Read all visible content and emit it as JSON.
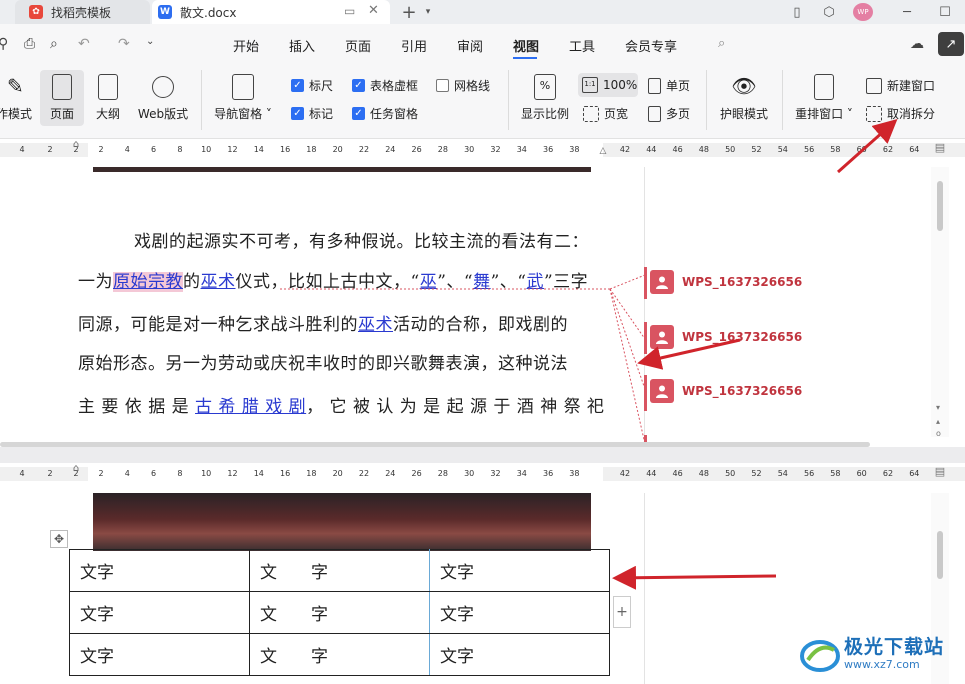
{
  "tabs": [
    {
      "label": "找稻壳模板"
    },
    {
      "label": "散文.docx"
    }
  ],
  "menu": [
    "开始",
    "插入",
    "页面",
    "引用",
    "审阅",
    "视图",
    "工具",
    "会员专享"
  ],
  "menu_active": "视图",
  "ribbon": {
    "write_mode": "作模式",
    "page_view": "页面",
    "outline": "大纲",
    "web_layout": "Web版式",
    "nav_pane": "导航窗格",
    "ruler": "标尺",
    "mark": "标记",
    "table_grid": "表格虚框",
    "task_pane": "任务窗格",
    "gridlines": "网格线",
    "zoom": "显示比例",
    "zoom_100": "100%",
    "page_width": "页宽",
    "single_page": "单页",
    "multi_page": "多页",
    "eye_mode": "护眼模式",
    "rearrange": "重排窗口",
    "new_window": "新建窗口",
    "cancel_split": "取消拆分"
  },
  "ruler_left": [
    "4",
    "2",
    "2"
  ],
  "ruler_main": [
    "2",
    "4",
    "6",
    "8",
    "10",
    "12",
    "14",
    "16",
    "18",
    "20",
    "22",
    "24",
    "26",
    "28",
    "30",
    "32",
    "34",
    "36",
    "38"
  ],
  "ruler_right": [
    "42",
    "44",
    "46",
    "48",
    "50",
    "52",
    "54",
    "56",
    "58",
    "60",
    "62",
    "64"
  ],
  "doc": {
    "line1": "戏剧的起源实不可考，有多种假说。比较主流的看法有二：",
    "line2_a": "一为",
    "line2_b": "原始宗教",
    "line2_c": "的",
    "line2_d": "巫术",
    "line2_e": "仪式，比如上古中文，“",
    "line2_f": "巫",
    "line2_g": "”、“",
    "line2_h": "舞",
    "line2_i": "”、“",
    "line2_j": "武",
    "line2_k": "”三字",
    "line3_a": "同源，可能是对一种乞求战斗胜利的",
    "line3_b": "巫术",
    "line3_c": "活动的合称，即戏剧的",
    "line4": "原始形态。另一为劳动或庆祝丰收时的即兴歌舞表演，这种说法",
    "line5_a": "主 要 依 据 是 ",
    "line5_b": "古 希 腊 戏 剧",
    "line5_c": "， 它 被 认 为 是 起 源 于 酒 神 祭 祀"
  },
  "comments": [
    {
      "author": "WPS_1637326656"
    },
    {
      "author": "WPS_1637326656"
    },
    {
      "author": "WPS_1637326656"
    }
  ],
  "table": [
    [
      "文字",
      "文　　字",
      "文字"
    ],
    [
      "文字",
      "文　　字",
      "文字"
    ],
    [
      "文字",
      "文　　字",
      "文字"
    ]
  ],
  "watermark": "极光下载站 www.xz7.com",
  "colors": {
    "accent": "#2c6ef2",
    "annotation_arrow": "#d0242b",
    "comment": "#d95461"
  }
}
